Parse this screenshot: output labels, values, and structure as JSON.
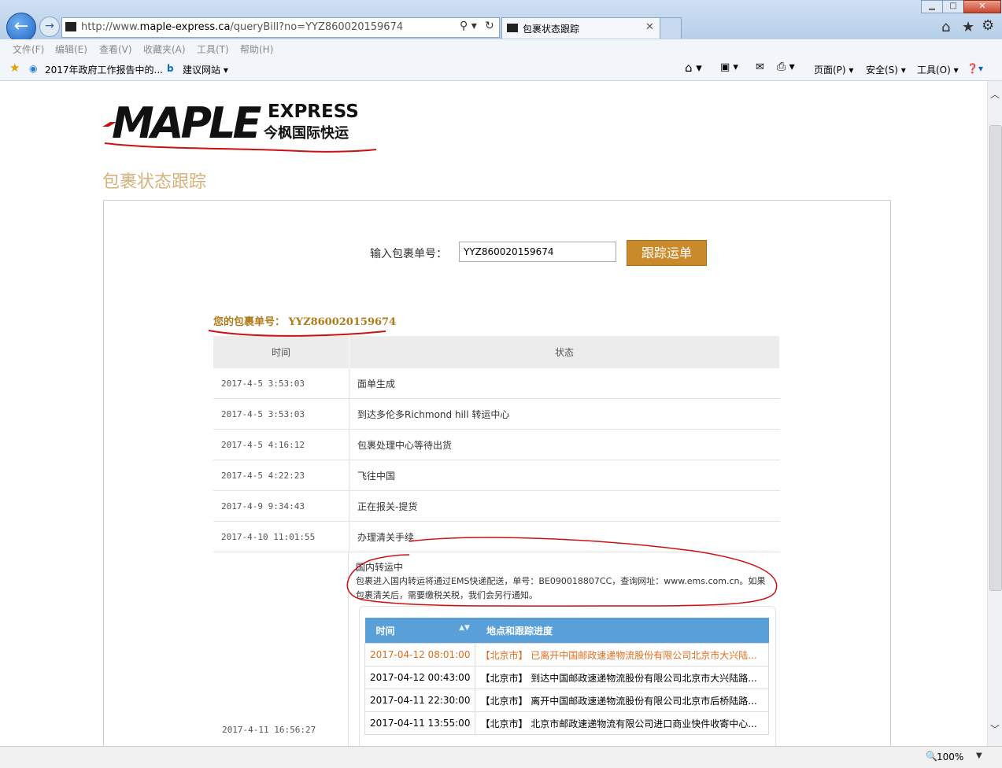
{
  "browser": {
    "url_prefix": "http://www.",
    "url_domain": "maple-express.ca",
    "url_path": "/queryBill?no=YYZ860020159674",
    "tab_title": "包裹状态跟踪",
    "favicon_text": "MAPLE"
  },
  "menu": [
    "文件(F)",
    "编辑(E)",
    "查看(V)",
    "收藏夹(A)",
    "工具(T)",
    "帮助(H)"
  ],
  "favorites": {
    "item1": "2017年政府工作报告中的...",
    "item2": "建议网站 ▾"
  },
  "toolbar": {
    "page": "页面(P) ▾",
    "safety": "安全(S) ▾",
    "tools": "工具(O) ▾"
  },
  "logo": {
    "brand": "MAPLE",
    "express": "EXPRESS",
    "chinese": "今枫国际快运"
  },
  "page": {
    "heading": "包裹状态跟踪",
    "search_label": "输入包裹单号：",
    "search_value": "YYZ860020159674",
    "track_button": "跟踪运单",
    "result_label": "您的包裹单号： YYZ860020159674"
  },
  "tracking": {
    "headers": {
      "time": "时间",
      "status": "状态"
    },
    "rows": [
      {
        "time": "2017-4-5 3:53:03",
        "status": "面单生成"
      },
      {
        "time": "2017-4-5 3:53:03",
        "status": "到达多伦多Richmond hill 转运中心"
      },
      {
        "time": "2017-4-5 4:16:12",
        "status": "包裹处理中心等待出货"
      },
      {
        "time": "2017-4-5 4:22:23",
        "status": "飞往中国"
      },
      {
        "time": "2017-4-9 9:34:43",
        "status": "正在报关-提货"
      },
      {
        "time": "2017-4-10 11:01:55",
        "status": "办理清关手续"
      }
    ],
    "last": {
      "time": "2017-4-11 16:56:27",
      "status": "国内转运中",
      "description": "包裹进入国内转运将通过EMS快递配送，单号：BE090018807CC，查询网址：www.ems.com.cn。如果包裹清关后，需要缴税关税，我们会另行通知。"
    }
  },
  "ems": {
    "headers": {
      "time": "时间",
      "location": "地点和跟踪进度"
    },
    "sort_icon": "sort-arrows",
    "rows": [
      {
        "time": "2017-04-12 08:01:00",
        "location": "【北京市】 已离开中国邮政速递物流股份有限公司北京市大兴陆..."
      },
      {
        "time": "2017-04-12 00:43:00",
        "location": "【北京市】 到达中国邮政速递物流股份有限公司北京市大兴陆路..."
      },
      {
        "time": "2017-04-11 22:30:00",
        "location": "【北京市】 离开中国邮政速递物流股份有限公司北京市后桥陆路..."
      },
      {
        "time": "2017-04-11 13:55:00",
        "location": "【北京市】 北京市邮政速递物流有限公司进口商业快件收寄中心..."
      }
    ]
  },
  "status_bar": {
    "zoom": "100%"
  },
  "colors": {
    "accent": "#c88a2a",
    "heading": "#d6b27a",
    "ems_header": "#5aa0d8",
    "highlight_row": "#e06d1c",
    "annotation": "#cc1111"
  }
}
